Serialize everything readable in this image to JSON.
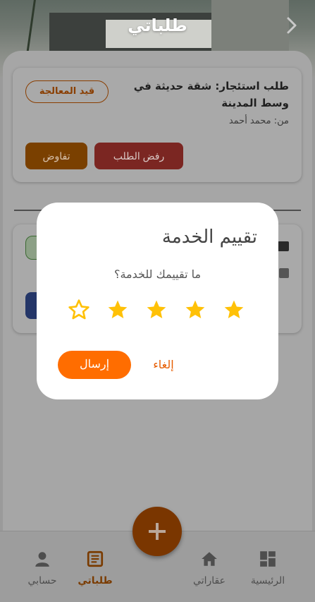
{
  "header": {
    "title": "طلباتي"
  },
  "requests": [
    {
      "title": "طلب استئجار: شقة حديثة في وسط المدينة",
      "from": "من: محمد أحمد",
      "status": "قيد المعالجة",
      "reject_label": "رفض الطلب",
      "negotiate_label": "تفاوض"
    }
  ],
  "dialog": {
    "title": "تقييم الخدمة",
    "question": "ما تقييمك للخدمة؟",
    "rating": 4,
    "max_rating": 5,
    "submit_label": "إرسال",
    "cancel_label": "إلغاء"
  },
  "bottom_nav": [
    {
      "label": "الرئيسية",
      "icon": "dashboard-icon",
      "active": false
    },
    {
      "label": "عقاراتي",
      "icon": "home-icon",
      "active": false
    },
    {
      "label": "طلباتي",
      "icon": "list-icon",
      "active": true
    },
    {
      "label": "حسابي",
      "icon": "person-icon",
      "active": false
    }
  ],
  "colors": {
    "accent": "#ff6d00",
    "star": "#ffc107",
    "overlay": "rgba(0,0,0,0.4)"
  }
}
